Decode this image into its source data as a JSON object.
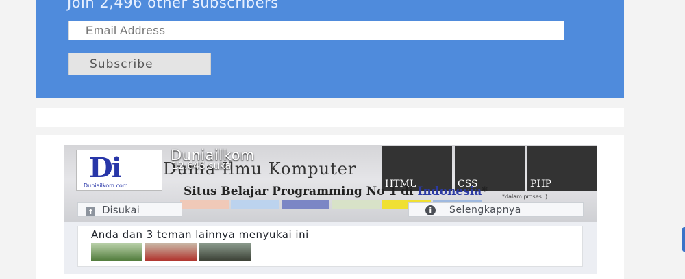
{
  "subscribe": {
    "join_text": "Join 2,496 other subscribers",
    "email_placeholder": "Email Address",
    "button_label": "Subscribe"
  },
  "facebook": {
    "logo_text": "Di",
    "logo_url": "Duniailkom.com",
    "page_name": "Duniailkom",
    "like_count": "12.645 suka",
    "cover_title": "Dunia Ilmu Komputer",
    "cover_subtitle_prefix": "Situs Belajar Programming No 1 di ",
    "cover_subtitle_highlight": "Indonesia",
    "cover_subtitle_suffix": "*",
    "cover_note": "*dalam proses :)",
    "thumbnails": [
      "HTML",
      "CSS",
      "PHP"
    ],
    "liked_label": "Disukai",
    "learn_more_label": "Selengkapnya",
    "friends_text": "Anda dan 3 teman lainnya menyukai ini",
    "friend_count": 3
  },
  "colors": {
    "widget_blue": "#4f8bdc",
    "brand_blue": "#2836a8",
    "facebook_gray": "#4b4f56"
  },
  "icons": {
    "like": "facebook-icon",
    "info": "info-icon"
  }
}
